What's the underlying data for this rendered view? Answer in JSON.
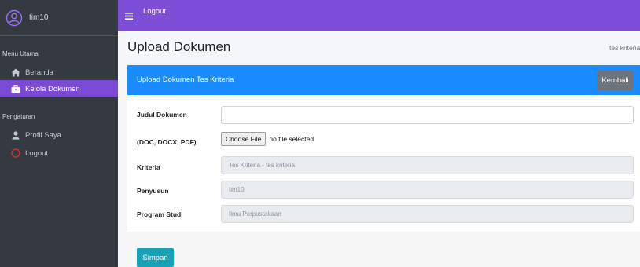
{
  "colors": {
    "sidebar_bg": "#343a40",
    "active_item": "#7a49d5",
    "topbar": "#7e4fd6",
    "card_header": "#1a8cff",
    "back_button": "#6c757d",
    "save_button": "#17a2b8"
  },
  "sidebar": {
    "user": {
      "name": "tim10",
      "icon": "user-circle-icon"
    },
    "section_main": "Menu Utama",
    "items_main": [
      {
        "label": "Beranda",
        "icon": "home-icon"
      },
      {
        "label": "Kelola Dokumen",
        "icon": "briefcase-icon",
        "active": true
      }
    ],
    "section_settings": "Pengaturan",
    "items_settings": [
      {
        "label": "Profil Saya",
        "icon": "user-icon"
      },
      {
        "label": "Logout",
        "icon": "circle-icon"
      }
    ]
  },
  "topbar": {
    "menu_icon": "hamburger-icon",
    "logout_label": "Logout"
  },
  "page": {
    "title": "Upload Dokumen",
    "breadcrumb": "tes kriteria"
  },
  "card": {
    "title": "Upload Dokumen Tes Kriteria",
    "back_label": "Kembali",
    "save_label": "Simpan"
  },
  "form": {
    "judul": {
      "label": "Judul Dokumen",
      "value": ""
    },
    "file": {
      "label": "(DOC, DOCX, PDF)",
      "button": "Choose File",
      "status": "no file selected"
    },
    "kriteria": {
      "label": "Kriteria",
      "value": "Tes Kriteria - tes kriteria"
    },
    "penyusun": {
      "label": "Penyusun",
      "value": "tim10"
    },
    "prodi": {
      "label": "Program Studi",
      "value": "Ilmu Perpustakaan"
    }
  }
}
